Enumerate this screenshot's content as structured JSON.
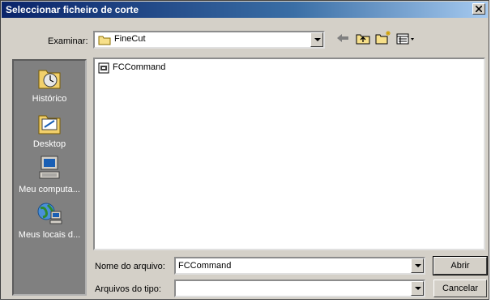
{
  "window": {
    "title": "Seleccionar ficheiro de corte"
  },
  "lookin": {
    "label": "Examinar:",
    "value": "FineCut"
  },
  "toolbar": {
    "icons": [
      "back-arrow-icon",
      "up-folder-icon",
      "new-folder-icon",
      "view-menu-icon"
    ]
  },
  "places": [
    {
      "label": "Histórico",
      "icon": "history-icon"
    },
    {
      "label": "Desktop",
      "icon": "desktop-icon"
    },
    {
      "label": "Meu computa...",
      "icon": "my-computer-icon"
    },
    {
      "label": "Meus locais d...",
      "icon": "network-places-icon"
    }
  ],
  "files": [
    {
      "name": "FCCommand",
      "icon": "file-icon"
    }
  ],
  "filename": {
    "label": "Nome do arquivo:",
    "value": "FCCommand"
  },
  "filetype": {
    "label": "Arquivos do tipo:",
    "value": ""
  },
  "buttons": {
    "open": "Abrir",
    "cancel": "Cancelar"
  }
}
